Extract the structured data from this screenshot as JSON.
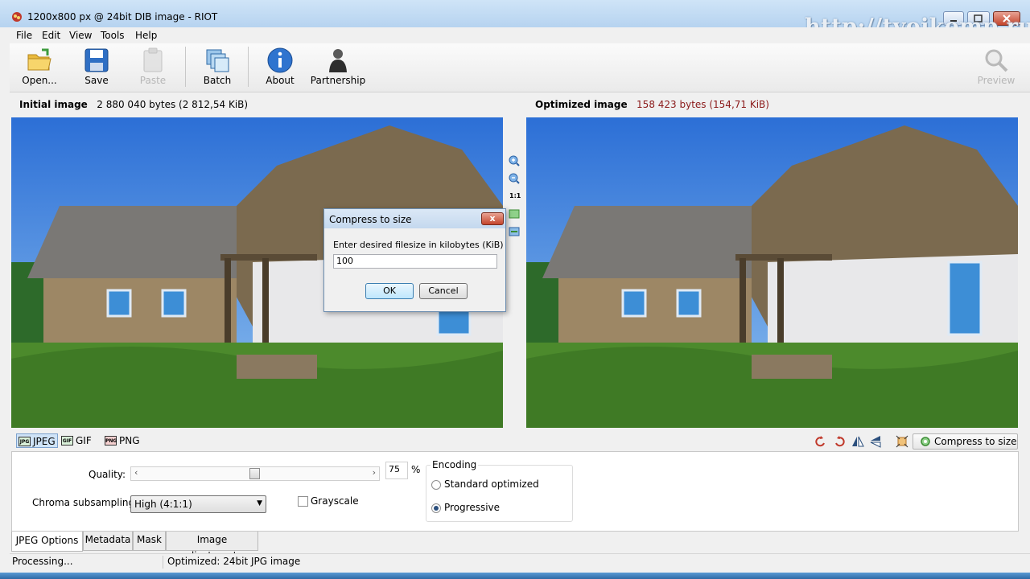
{
  "window": {
    "title": "1200x800 px @ 24bit  DIB image - RIOT",
    "watermark": "http://tvojkomp.ru"
  },
  "menu": [
    "File",
    "Edit",
    "View",
    "Tools",
    "Help"
  ],
  "toolbar": {
    "open": "Open...",
    "save": "Save",
    "paste": "Paste",
    "batch": "Batch",
    "about": "About",
    "partnership": "Partnership",
    "preview": "Preview"
  },
  "initial": {
    "label": "Initial image",
    "size": "2 880 040 bytes (2 812,54 KiB)"
  },
  "optimized": {
    "label": "Optimized image",
    "size": "158 423 bytes (154,71 KiB)",
    "size_color": "#8b1a1a"
  },
  "zoom": {
    "one_to_one": "1:1"
  },
  "dialog": {
    "title": "Compress to size",
    "prompt": "Enter desired filesize in kilobytes (KiB)",
    "value": "100",
    "ok": "OK",
    "cancel": "Cancel",
    "close": "x"
  },
  "formats": {
    "jpeg": "JPEG",
    "gif": "GIF",
    "png": "PNG",
    "jpeg_icon": "JPG",
    "gif_icon": "GIF",
    "png_icon": "PNG"
  },
  "compress_button": "Compress to size",
  "options": {
    "quality_label": "Quality:",
    "quality_value": "75",
    "quality_percent": "%",
    "quality_fraction": 0.75,
    "slider_left": "‹",
    "slider_right": "›",
    "chroma_label": "Chroma subsampling:",
    "chroma_value": "High (4:1:1)",
    "grayscale": "Grayscale",
    "encoding_title": "Encoding",
    "encoding_standard": "Standard optimized",
    "encoding_progressive": "Progressive"
  },
  "tabs": [
    "JPEG Options",
    "Metadata",
    "Mask",
    "Image adjustments"
  ],
  "status": {
    "left": "Processing...",
    "right": "Optimized: 24bit JPG image"
  }
}
